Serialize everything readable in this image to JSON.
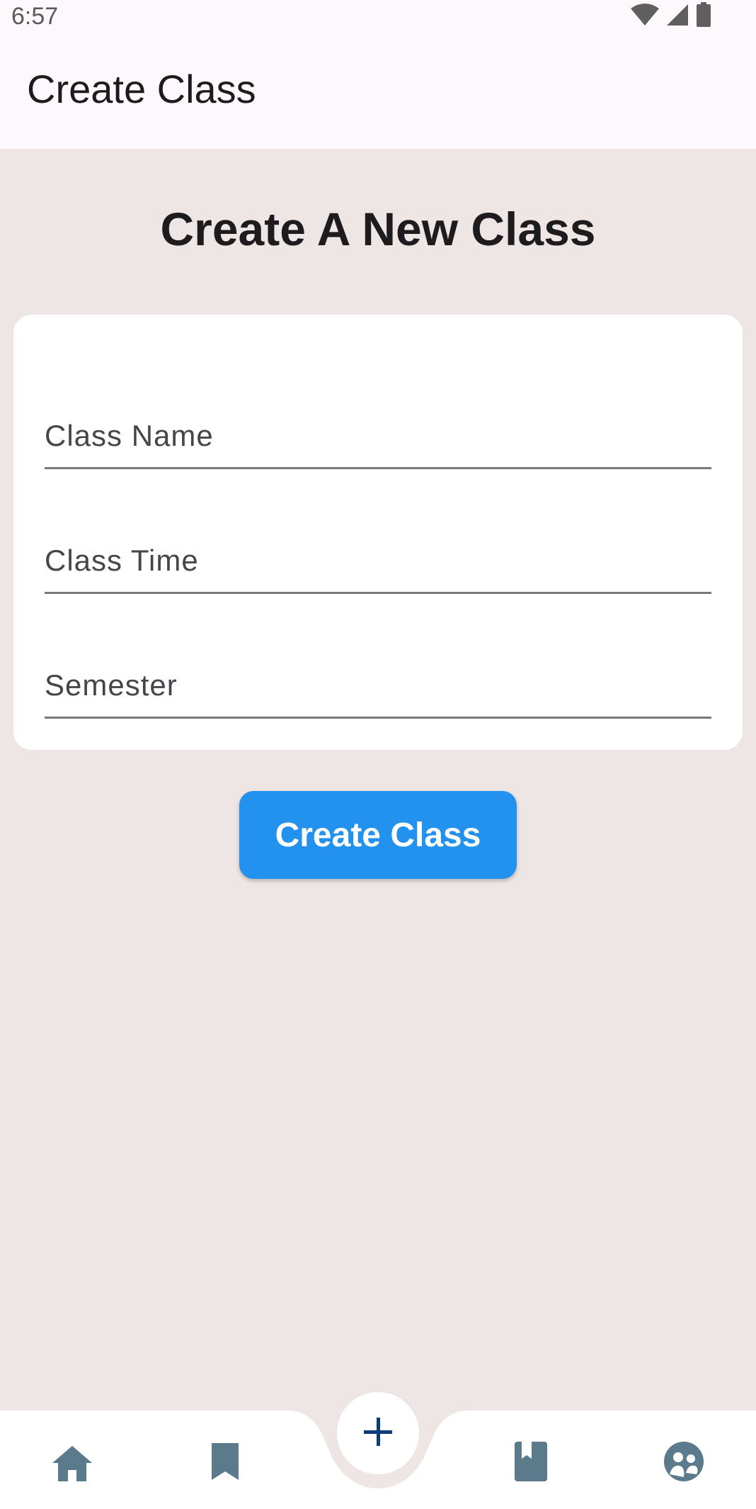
{
  "status_bar": {
    "time": "6:57",
    "icons": [
      "wifi-icon",
      "cell-signal-icon",
      "battery-icon"
    ]
  },
  "app_bar": {
    "title": "Create Class"
  },
  "main": {
    "heading": "Create A New Class",
    "fields": [
      {
        "label": "Class Name",
        "value": ""
      },
      {
        "label": "Class Time",
        "value": ""
      },
      {
        "label": "Semester",
        "value": ""
      }
    ],
    "submit_label": "Create Class"
  },
  "bottom_nav": {
    "items": [
      "home-icon",
      "bookmark-icon",
      "add-icon",
      "book-icon",
      "group-icon"
    ]
  },
  "colors": {
    "background": "#eee6e5",
    "app_bar": "#fdf8fb",
    "primary_button": "#2392ee",
    "nav_icon": "#5b7a8c",
    "fab_icon": "#0d3a78"
  }
}
